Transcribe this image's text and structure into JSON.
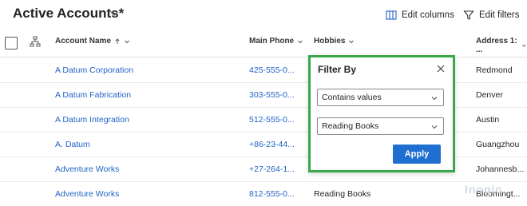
{
  "header": {
    "view_title": "Active Accounts*",
    "edit_columns": "Edit columns",
    "edit_filters": "Edit filters"
  },
  "columns": {
    "account_name": "Account Name",
    "main_phone": "Main Phone",
    "hobbies": "Hobbies",
    "address": "Address 1: ..."
  },
  "rows": [
    {
      "name": "A Datum Corporation",
      "phone": "425-555-0...",
      "hobbies": "",
      "address": "Redmond"
    },
    {
      "name": "A Datum Fabrication",
      "phone": "303-555-0...",
      "hobbies": "",
      "address": "Denver"
    },
    {
      "name": "A Datum Integration",
      "phone": "512-555-0...",
      "hobbies": "",
      "address": "Austin"
    },
    {
      "name": "A. Datum",
      "phone": "+86-23-44...",
      "hobbies": "",
      "address": "Guangzhou"
    },
    {
      "name": "Adventure Works",
      "phone": "+27-264-1...",
      "hobbies": "",
      "address": "Johannesb..."
    },
    {
      "name": "Adventure Works",
      "phone": "812-555-0...",
      "hobbies": "Reading Books",
      "address": "Bloomingt..."
    }
  ],
  "filter_popup": {
    "title": "Filter By",
    "operator_value": "Contains values",
    "value_selected": "Reading Books",
    "apply_label": "Apply"
  },
  "watermark": "Inogic",
  "colors": {
    "link": "#1f63c6",
    "apply_button": "#1f6fd1",
    "popup_highlight": "#3aa84a"
  },
  "icons": {
    "edit_columns": "columns-icon",
    "edit_filters": "funnel-icon",
    "hierarchy": "hierarchy-icon",
    "close": "close-icon"
  }
}
